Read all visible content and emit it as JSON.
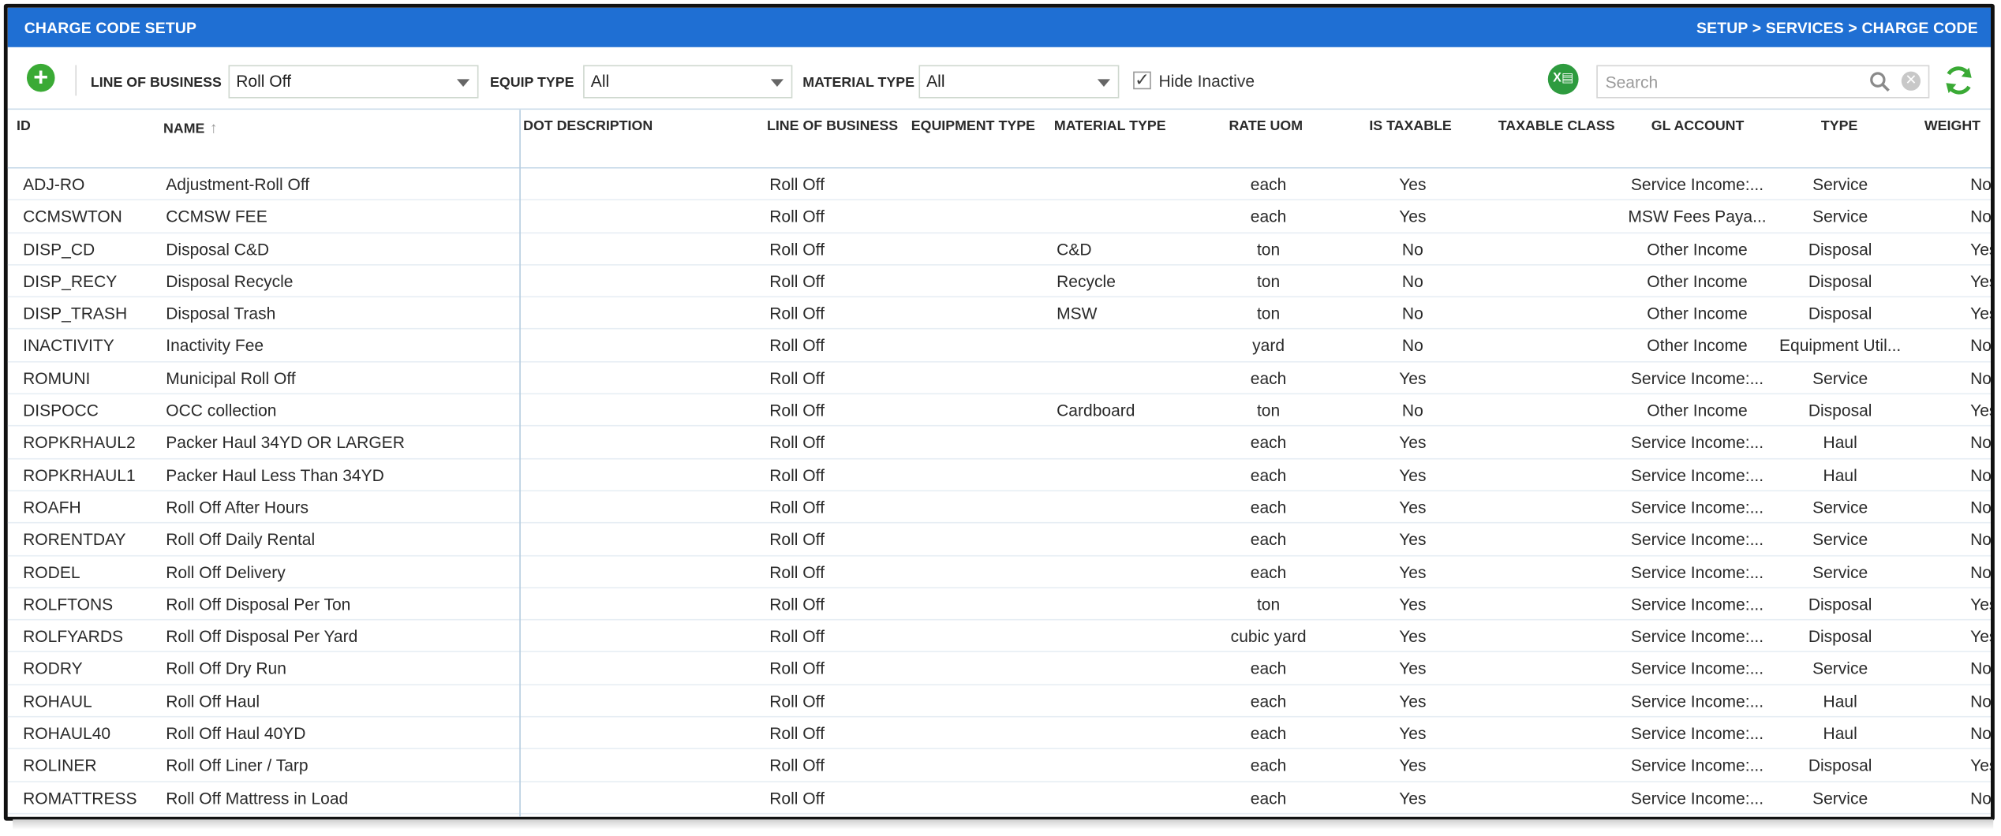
{
  "titlebar": {
    "title": "CHARGE CODE SETUP",
    "breadcrumb": "SETUP > SERVICES > CHARGE CODE"
  },
  "toolbar": {
    "add_icon": "plus-circle-icon",
    "line_of_business_label": "LINE OF BUSINESS",
    "line_of_business_value": "Roll Off",
    "equip_type_label": "EQUIP TYPE",
    "equip_type_value": "All",
    "material_type_label": "MATERIAL TYPE",
    "material_type_value": "All",
    "hide_inactive_label": "Hide Inactive",
    "hide_inactive_checked": true,
    "excel_icon": "excel-export-icon",
    "search_placeholder": "Search",
    "refresh_icon": "refresh-icon",
    "accent_green": "#3aaa35",
    "title_blue": "#1f6fd3"
  },
  "columns": [
    "ID",
    "NAME",
    "DOT DESCRIPTION",
    "LINE OF BUSINESS",
    "EQUIPMENT TYPE",
    "MATERIAL TYPE",
    "RATE UOM",
    "IS TAXABLE",
    "TAXABLE CLASS",
    "GL ACCOUNT",
    "TYPE",
    "WEIGHT"
  ],
  "rows": [
    {
      "id": "ADJ-RO",
      "name": "Adjustment-Roll Off",
      "dot": "",
      "lob": "Roll Off",
      "equip": "",
      "material": "",
      "uom": "each",
      "taxable": "Yes",
      "tax_class": "",
      "gl": "Service Income:...",
      "type": "Service",
      "weight": "No"
    },
    {
      "id": "CCMSWTON",
      "name": "CCMSW FEE",
      "dot": "",
      "lob": "Roll Off",
      "equip": "",
      "material": "",
      "uom": "each",
      "taxable": "Yes",
      "tax_class": "",
      "gl": "MSW Fees Paya...",
      "type": "Service",
      "weight": "No"
    },
    {
      "id": "DISP_CD",
      "name": "Disposal C&D",
      "dot": "",
      "lob": "Roll Off",
      "equip": "",
      "material": "C&D",
      "uom": "ton",
      "taxable": "No",
      "tax_class": "",
      "gl": "Other Income",
      "type": "Disposal",
      "weight": "Yes"
    },
    {
      "id": "DISP_RECY",
      "name": "Disposal Recycle",
      "dot": "",
      "lob": "Roll Off",
      "equip": "",
      "material": "Recycle",
      "uom": "ton",
      "taxable": "No",
      "tax_class": "",
      "gl": "Other Income",
      "type": "Disposal",
      "weight": "Yes"
    },
    {
      "id": "DISP_TRASH",
      "name": "Disposal Trash",
      "dot": "",
      "lob": "Roll Off",
      "equip": "",
      "material": "MSW",
      "uom": "ton",
      "taxable": "No",
      "tax_class": "",
      "gl": "Other Income",
      "type": "Disposal",
      "weight": "Yes"
    },
    {
      "id": "INACTIVITY",
      "name": "Inactivity Fee",
      "dot": "",
      "lob": "Roll Off",
      "equip": "",
      "material": "",
      "uom": "yard",
      "taxable": "No",
      "tax_class": "",
      "gl": "Other Income",
      "type": "Equipment Util...",
      "weight": "No"
    },
    {
      "id": "ROMUNI",
      "name": "Municipal Roll Off",
      "dot": "",
      "lob": "Roll Off",
      "equip": "",
      "material": "",
      "uom": "each",
      "taxable": "Yes",
      "tax_class": "",
      "gl": "Service Income:...",
      "type": "Service",
      "weight": "No"
    },
    {
      "id": "DISPOCC",
      "name": "OCC collection",
      "dot": "",
      "lob": "Roll Off",
      "equip": "",
      "material": "Cardboard",
      "uom": "ton",
      "taxable": "No",
      "tax_class": "",
      "gl": "Other Income",
      "type": "Disposal",
      "weight": "Yes"
    },
    {
      "id": "ROPKRHAUL2",
      "name": "Packer Haul 34YD OR LARGER",
      "dot": "",
      "lob": "Roll Off",
      "equip": "",
      "material": "",
      "uom": "each",
      "taxable": "Yes",
      "tax_class": "",
      "gl": "Service Income:...",
      "type": "Haul",
      "weight": "No"
    },
    {
      "id": "ROPKRHAUL1",
      "name": "Packer Haul Less Than 34YD",
      "dot": "",
      "lob": "Roll Off",
      "equip": "",
      "material": "",
      "uom": "each",
      "taxable": "Yes",
      "tax_class": "",
      "gl": "Service Income:...",
      "type": "Haul",
      "weight": "No"
    },
    {
      "id": "ROAFH",
      "name": "Roll Off After Hours",
      "dot": "",
      "lob": "Roll Off",
      "equip": "",
      "material": "",
      "uom": "each",
      "taxable": "Yes",
      "tax_class": "",
      "gl": "Service Income:...",
      "type": "Service",
      "weight": "No"
    },
    {
      "id": "RORENTDAY",
      "name": "Roll Off Daily Rental",
      "dot": "",
      "lob": "Roll Off",
      "equip": "",
      "material": "",
      "uom": "each",
      "taxable": "Yes",
      "tax_class": "",
      "gl": "Service Income:...",
      "type": "Service",
      "weight": "No"
    },
    {
      "id": "RODEL",
      "name": "Roll Off Delivery",
      "dot": "",
      "lob": "Roll Off",
      "equip": "",
      "material": "",
      "uom": "each",
      "taxable": "Yes",
      "tax_class": "",
      "gl": "Service Income:...",
      "type": "Service",
      "weight": "No"
    },
    {
      "id": "ROLFTONS",
      "name": "Roll Off Disposal Per Ton",
      "dot": "",
      "lob": "Roll Off",
      "equip": "",
      "material": "",
      "uom": "ton",
      "taxable": "Yes",
      "tax_class": "",
      "gl": "Service Income:...",
      "type": "Disposal",
      "weight": "Yes"
    },
    {
      "id": "ROLFYARDS",
      "name": "Roll Off Disposal Per Yard",
      "dot": "",
      "lob": "Roll Off",
      "equip": "",
      "material": "",
      "uom": "cubic yard",
      "taxable": "Yes",
      "tax_class": "",
      "gl": "Service Income:...",
      "type": "Disposal",
      "weight": "Yes"
    },
    {
      "id": "RODRY",
      "name": "Roll Off Dry Run",
      "dot": "",
      "lob": "Roll Off",
      "equip": "",
      "material": "",
      "uom": "each",
      "taxable": "Yes",
      "tax_class": "",
      "gl": "Service Income:...",
      "type": "Service",
      "weight": "No"
    },
    {
      "id": "ROHAUL",
      "name": "Roll Off Haul",
      "dot": "",
      "lob": "Roll Off",
      "equip": "",
      "material": "",
      "uom": "each",
      "taxable": "Yes",
      "tax_class": "",
      "gl": "Service Income:...",
      "type": "Haul",
      "weight": "No"
    },
    {
      "id": "ROHAUL40",
      "name": "Roll Off Haul 40YD",
      "dot": "",
      "lob": "Roll Off",
      "equip": "",
      "material": "",
      "uom": "each",
      "taxable": "Yes",
      "tax_class": "",
      "gl": "Service Income:...",
      "type": "Haul",
      "weight": "No"
    },
    {
      "id": "ROLINER",
      "name": "Roll Off Liner / Tarp",
      "dot": "",
      "lob": "Roll Off",
      "equip": "",
      "material": "",
      "uom": "each",
      "taxable": "Yes",
      "tax_class": "",
      "gl": "Service Income:...",
      "type": "Disposal",
      "weight": "Yes"
    },
    {
      "id": "ROMATTRESS",
      "name": "Roll Off Mattress in Load",
      "dot": "",
      "lob": "Roll Off",
      "equip": "",
      "material": "",
      "uom": "each",
      "taxable": "Yes",
      "tax_class": "",
      "gl": "Service Income:...",
      "type": "Service",
      "weight": "No"
    }
  ]
}
